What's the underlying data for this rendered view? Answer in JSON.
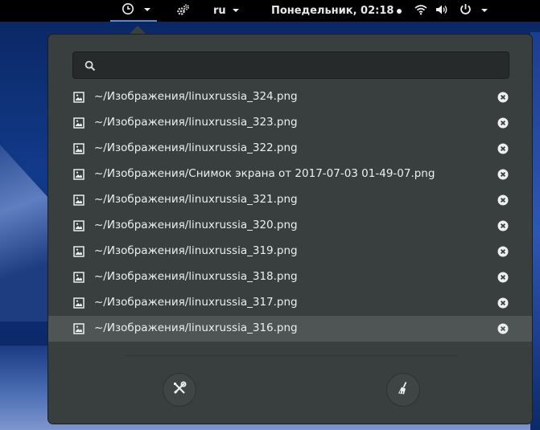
{
  "topbar": {
    "clock_text": "Понедельник, 02:18",
    "language": "ru",
    "icons": [
      "clipboard-history-icon",
      "chevron-down-icon",
      "settings-gears-icon",
      "wifi-icon",
      "volume-icon",
      "power-icon"
    ]
  },
  "search": {
    "placeholder": "",
    "value": ""
  },
  "items": [
    {
      "path": "~/Изображения/linuxrussia_324.png"
    },
    {
      "path": "~/Изображения/linuxrussia_323.png"
    },
    {
      "path": "~/Изображения/linuxrussia_322.png"
    },
    {
      "path": "~/Изображения/Снимок экрана от 2017-07-03 01-49-07.png"
    },
    {
      "path": "~/Изображения/linuxrussia_321.png"
    },
    {
      "path": "~/Изображения/linuxrussia_320.png"
    },
    {
      "path": "~/Изображения/linuxrussia_319.png"
    },
    {
      "path": "~/Изображения/linuxrussia_318.png"
    },
    {
      "path": "~/Изображения/linuxrussia_317.png"
    },
    {
      "path": "~/Изображения/linuxrussia_316.png"
    }
  ],
  "selected_index": 9,
  "colors": {
    "popup_bg": "#393f3f",
    "selected_row": "#4f5555",
    "topbar_bg": "#000000",
    "accent": "#4a90d9"
  }
}
